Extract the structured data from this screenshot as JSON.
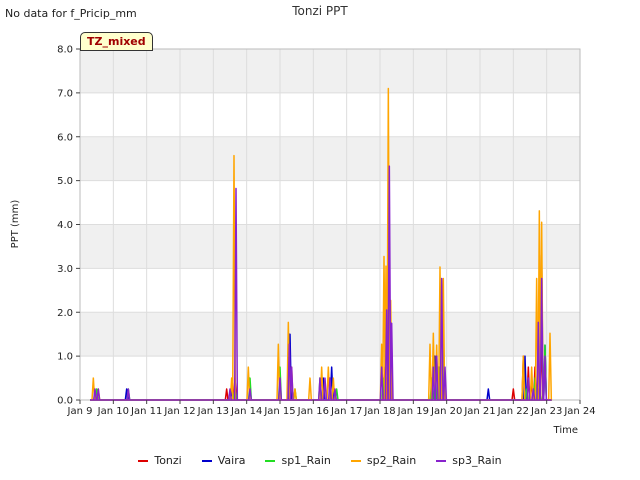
{
  "header": {
    "nodata_text": "No data for f_Pricip_mm",
    "title": "Tonzi PPT",
    "badge": "TZ_mixed"
  },
  "chart_data": {
    "type": "line",
    "title": "Tonzi PPT",
    "xlabel": "Time",
    "ylabel": "PPT (mm)",
    "xlim": [
      9,
      24
    ],
    "ylim": [
      0,
      8.0
    ],
    "x_ticks": [
      9,
      10,
      11,
      12,
      13,
      14,
      15,
      16,
      17,
      18,
      19,
      20,
      21,
      22,
      23,
      24
    ],
    "x_tick_labels": [
      "Jan 9",
      "Jan 10",
      "Jan 11",
      "Jan 12",
      "Jan 13",
      "Jan 14",
      "Jan 15",
      "Jan 16",
      "Jan 17",
      "Jan 18",
      "Jan 19",
      "Jan 20",
      "Jan 21",
      "Jan 22",
      "Jan 23",
      "Jan 24"
    ],
    "y_ticks": [
      0,
      1,
      2,
      3,
      4,
      5,
      6,
      7,
      8
    ],
    "y_tick_labels": [
      "0.0",
      "1.0",
      "2.0",
      "3.0",
      "4.0",
      "5.0",
      "6.0",
      "7.0",
      "8.0"
    ],
    "grid": true,
    "legend_position": "bottom",
    "series": [
      {
        "name": "Tonzi",
        "color": "#dd0000",
        "points": [
          [
            13.4,
            0.25
          ],
          [
            13.55,
            0.25
          ],
          [
            13.65,
            0.5
          ],
          [
            18.15,
            0.75
          ],
          [
            18.2,
            0.5
          ],
          [
            22.0,
            0.25
          ],
          [
            22.3,
            1.0
          ],
          [
            22.45,
            0.75
          ],
          [
            22.55,
            0.5
          ],
          [
            22.65,
            0.75
          ],
          [
            22.75,
            0.25
          ],
          [
            22.85,
            1.5
          ]
        ]
      },
      {
        "name": "Vaira",
        "color": "#0000cc",
        "points": [
          [
            10.4,
            0.25
          ],
          [
            13.55,
            0.25
          ],
          [
            15.3,
            1.5
          ],
          [
            16.3,
            0.5
          ],
          [
            16.55,
            0.75
          ],
          [
            18.25,
            1.25
          ],
          [
            18.3,
            0.75
          ],
          [
            19.65,
            1.0
          ],
          [
            19.8,
            0.75
          ],
          [
            21.25,
            0.25
          ],
          [
            22.35,
            1.0
          ],
          [
            22.85,
            3.3
          ],
          [
            22.95,
            1.25
          ]
        ]
      },
      {
        "name": "sp1_Rain",
        "color": "#22dd22",
        "points": [
          [
            9.5,
            0.25
          ],
          [
            10.45,
            0.25
          ],
          [
            13.65,
            0.25
          ],
          [
            14.1,
            0.5
          ],
          [
            15.0,
            0.75
          ],
          [
            15.45,
            0.25
          ],
          [
            16.2,
            0.5
          ],
          [
            16.7,
            0.25
          ],
          [
            18.1,
            0.5
          ],
          [
            19.55,
            0.5
          ],
          [
            19.75,
            0.75
          ],
          [
            19.9,
            1.75
          ],
          [
            22.4,
            0.25
          ],
          [
            22.65,
            0.5
          ],
          [
            22.8,
            0.25
          ],
          [
            22.95,
            1.25
          ]
        ]
      },
      {
        "name": "sp2_Rain",
        "color": "#ffa500",
        "points": [
          [
            9.4,
            0.5
          ],
          [
            9.55,
            0.25
          ],
          [
            13.55,
            0.5
          ],
          [
            13.62,
            5.57
          ],
          [
            14.05,
            0.75
          ],
          [
            14.95,
            1.27
          ],
          [
            15.25,
            1.77
          ],
          [
            15.35,
            0.75
          ],
          [
            15.45,
            0.25
          ],
          [
            15.9,
            0.5
          ],
          [
            16.25,
            0.75
          ],
          [
            16.45,
            0.75
          ],
          [
            16.6,
            0.5
          ],
          [
            18.05,
            1.27
          ],
          [
            18.12,
            3.27
          ],
          [
            18.18,
            3.05
          ],
          [
            18.25,
            7.1
          ],
          [
            18.32,
            2.27
          ],
          [
            19.5,
            1.27
          ],
          [
            19.6,
            1.52
          ],
          [
            19.7,
            1.25
          ],
          [
            19.8,
            3.03
          ],
          [
            19.9,
            2.77
          ],
          [
            22.3,
            1.0
          ],
          [
            22.55,
            0.75
          ],
          [
            22.7,
            2.77
          ],
          [
            22.78,
            4.31
          ],
          [
            22.85,
            4.05
          ],
          [
            23.1,
            1.52
          ]
        ]
      },
      {
        "name": "sp3_Rain",
        "color": "#8822cc",
        "points": [
          [
            9.45,
            0.25
          ],
          [
            9.55,
            0.25
          ],
          [
            10.45,
            0.25
          ],
          [
            13.5,
            0.25
          ],
          [
            13.68,
            4.82
          ],
          [
            14.1,
            0.25
          ],
          [
            15.0,
            0.5
          ],
          [
            15.28,
            1.27
          ],
          [
            15.35,
            0.75
          ],
          [
            16.2,
            0.5
          ],
          [
            16.35,
            0.5
          ],
          [
            16.5,
            0.5
          ],
          [
            16.65,
            0.25
          ],
          [
            18.05,
            0.75
          ],
          [
            18.2,
            2.05
          ],
          [
            18.28,
            5.33
          ],
          [
            18.35,
            1.75
          ],
          [
            19.6,
            0.75
          ],
          [
            19.7,
            1.0
          ],
          [
            19.85,
            2.77
          ],
          [
            19.95,
            0.75
          ],
          [
            22.45,
            0.5
          ],
          [
            22.6,
            0.25
          ],
          [
            22.75,
            1.77
          ],
          [
            22.85,
            2.77
          ],
          [
            22.95,
            1.0
          ]
        ]
      }
    ]
  }
}
